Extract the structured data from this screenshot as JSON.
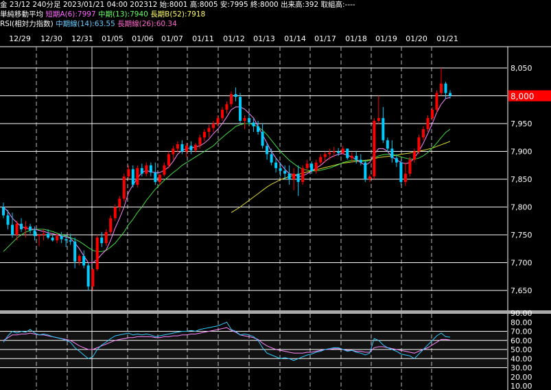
{
  "header": {
    "line1": "金 23/12 240分足 2023/01/21 04:00 202312 始:8001 高:8005 安:7995 終:8000 出来高:392 取組高:----",
    "ma_title": "単純移動平均",
    "ma_short": "短期A(6):7997",
    "ma_mid": "中期(13):7940",
    "ma_long": "長期B(52):7918",
    "rsi_title": "RSI(相対力指数)",
    "rsi_mid": "中期線(14):63.55",
    "rsi_long": "長期線(26):60.34"
  },
  "colors": {
    "up": "#ff0000",
    "down": "#00ccff",
    "ma_short": "#ff88ff",
    "ma_mid": "#44dd44",
    "ma_long": "#dddd33",
    "rsi_mid": "#33ccff",
    "rsi_long": "#ff88ff",
    "current_price_bg": "#ff0000"
  },
  "chart_data": [
    {
      "type": "candlestick",
      "title": "",
      "x_labels": [
        "12/29",
        "12/30",
        "12/31",
        "01/05",
        "01/06",
        "01/07",
        "01/11",
        "01/12",
        "01/13",
        "01/14",
        "01/17",
        "01/18",
        "01/19",
        "01/20",
        "01/21"
      ],
      "y_ticks": [
        "8,050",
        "8,000",
        "7,950",
        "7,900",
        "7,850",
        "7,800",
        "7,750",
        "7,700",
        "7,650"
      ],
      "ylim": [
        7625,
        8080
      ],
      "current_price_label": "8,000",
      "current_price": 8000,
      "candles": [
        [
          7800,
          7808,
          7780,
          7785
        ],
        [
          7785,
          7795,
          7760,
          7768
        ],
        [
          7768,
          7790,
          7745,
          7750
        ],
        [
          7750,
          7775,
          7740,
          7770
        ],
        [
          7770,
          7780,
          7755,
          7760
        ],
        [
          7760,
          7775,
          7745,
          7765
        ],
        [
          7765,
          7770,
          7752,
          7758
        ],
        [
          7758,
          7765,
          7740,
          7748
        ],
        [
          7748,
          7752,
          7730,
          7750
        ],
        [
          7750,
          7760,
          7740,
          7752
        ],
        [
          7752,
          7760,
          7742,
          7745
        ],
        [
          7745,
          7750,
          7738,
          7740
        ],
        [
          7740,
          7752,
          7735,
          7748
        ],
        [
          7748,
          7755,
          7735,
          7742
        ],
        [
          7742,
          7750,
          7728,
          7740
        ],
        [
          7740,
          7752,
          7732,
          7738
        ],
        [
          7738,
          7745,
          7690,
          7702
        ],
        [
          7702,
          7715,
          7695,
          7712
        ],
        [
          7712,
          7722,
          7690,
          7695
        ],
        [
          7695,
          7700,
          7650,
          7657
        ],
        [
          7657,
          7690,
          7650,
          7688
        ],
        [
          7688,
          7750,
          7685,
          7745
        ],
        [
          7745,
          7755,
          7728,
          7735
        ],
        [
          7735,
          7760,
          7730,
          7755
        ],
        [
          7755,
          7785,
          7750,
          7780
        ],
        [
          7780,
          7805,
          7775,
          7800
        ],
        [
          7800,
          7820,
          7792,
          7815
        ],
        [
          7815,
          7860,
          7810,
          7855
        ],
        [
          7855,
          7875,
          7850,
          7868
        ],
        [
          7868,
          7875,
          7835,
          7840
        ],
        [
          7840,
          7875,
          7835,
          7870
        ],
        [
          7870,
          7878,
          7855,
          7860
        ],
        [
          7860,
          7880,
          7855,
          7875
        ],
        [
          7875,
          7880,
          7855,
          7862
        ],
        [
          7862,
          7880,
          7840,
          7845
        ],
        [
          7845,
          7860,
          7840,
          7858
        ],
        [
          7858,
          7880,
          7855,
          7875
        ],
        [
          7875,
          7900,
          7870,
          7895
        ],
        [
          7895,
          7910,
          7885,
          7905
        ],
        [
          7905,
          7918,
          7898,
          7913
        ],
        [
          7913,
          7920,
          7895,
          7900
        ],
        [
          7900,
          7915,
          7890,
          7910
        ],
        [
          7910,
          7918,
          7895,
          7902
        ],
        [
          7902,
          7915,
          7898,
          7912
        ],
        [
          7912,
          7930,
          7905,
          7925
        ],
        [
          7925,
          7940,
          7918,
          7935
        ],
        [
          7935,
          7948,
          7925,
          7942
        ],
        [
          7942,
          7955,
          7935,
          7950
        ],
        [
          7950,
          7965,
          7945,
          7960
        ],
        [
          7960,
          7980,
          7955,
          7975
        ],
        [
          7975,
          7990,
          7968,
          7985
        ],
        [
          7985,
          8008,
          7980,
          8003
        ],
        [
          8003,
          8015,
          7990,
          7998
        ],
        [
          7998,
          8005,
          7950,
          7955
        ],
        [
          7955,
          7965,
          7940,
          7960
        ],
        [
          7960,
          7968,
          7948,
          7952
        ],
        [
          7952,
          7960,
          7935,
          7945
        ],
        [
          7945,
          7955,
          7930,
          7935
        ],
        [
          7935,
          7950,
          7905,
          7910
        ],
        [
          7910,
          7915,
          7885,
          7895
        ],
        [
          7895,
          7905,
          7875,
          7880
        ],
        [
          7880,
          7888,
          7862,
          7870
        ],
        [
          7870,
          7880,
          7855,
          7865
        ],
        [
          7865,
          7875,
          7850,
          7860
        ],
        [
          7860,
          7875,
          7840,
          7850
        ],
        [
          7850,
          7870,
          7830,
          7860
        ],
        [
          7860,
          7875,
          7820,
          7845
        ],
        [
          7845,
          7875,
          7840,
          7870
        ],
        [
          7870,
          7885,
          7865,
          7878
        ],
        [
          7878,
          7882,
          7860,
          7865
        ],
        [
          7865,
          7885,
          7860,
          7880
        ],
        [
          7880,
          7895,
          7875,
          7890
        ],
        [
          7890,
          7900,
          7880,
          7895
        ],
        [
          7895,
          7905,
          7885,
          7898
        ],
        [
          7898,
          7908,
          7890,
          7900
        ],
        [
          7900,
          7906,
          7892,
          7897
        ],
        [
          7897,
          7910,
          7895,
          7905
        ],
        [
          7905,
          7905,
          7885,
          7888
        ],
        [
          7888,
          7898,
          7882,
          7892
        ],
        [
          7892,
          7900,
          7878,
          7885
        ],
        [
          7885,
          7895,
          7875,
          7880
        ],
        [
          7880,
          7885,
          7845,
          7850
        ],
        [
          7850,
          7858,
          7845,
          7855
        ],
        [
          7855,
          7960,
          7850,
          7955
        ],
        [
          7955,
          8000,
          7950,
          7960
        ],
        [
          7960,
          7980,
          7915,
          7920
        ],
        [
          7920,
          7925,
          7900,
          7905
        ],
        [
          7905,
          7920,
          7880,
          7888
        ],
        [
          7888,
          7895,
          7872,
          7880
        ],
        [
          7880,
          7885,
          7840,
          7845
        ],
        [
          7845,
          7880,
          7838,
          7860
        ],
        [
          7860,
          7890,
          7855,
          7885
        ],
        [
          7885,
          7905,
          7880,
          7900
        ],
        [
          7900,
          7930,
          7895,
          7925
        ],
        [
          7925,
          7945,
          7920,
          7940
        ],
        [
          7940,
          7965,
          7935,
          7960
        ],
        [
          7960,
          7980,
          7955,
          7975
        ],
        [
          7975,
          8010,
          7970,
          8005
        ],
        [
          8005,
          8050,
          8000,
          8022
        ],
        [
          8022,
          8025,
          7995,
          8005
        ],
        [
          8005,
          8010,
          7995,
          8000
        ]
      ],
      "ma_short": [
        7800,
        7792,
        7780,
        7772,
        7765,
        7762,
        7760,
        7760,
        7758,
        7756,
        7754,
        7752,
        7750,
        7748,
        7746,
        7744,
        7735,
        7725,
        7712,
        7700,
        7700,
        7706,
        7715,
        7723,
        7740,
        7762,
        7780,
        7800,
        7826,
        7840,
        7852,
        7862,
        7866,
        7863,
        7862,
        7862,
        7866,
        7872,
        7882,
        7895,
        7902,
        7905,
        7906,
        7908,
        7910,
        7915,
        7922,
        7932,
        7940,
        7950,
        7962,
        7975,
        7980,
        7980,
        7976,
        7968,
        7960,
        7945,
        7930,
        7915,
        7900,
        7888,
        7878,
        7868,
        7860,
        7858,
        7855,
        7856,
        7860,
        7865,
        7870,
        7875,
        7882,
        7888,
        7892,
        7895,
        7896,
        7893,
        7890,
        7885,
        7880,
        7875,
        7880,
        7895,
        7905,
        7905,
        7900,
        7890,
        7885,
        7880,
        7878,
        7880,
        7888,
        7900,
        7915,
        7932,
        7950,
        7970,
        7985,
        7995,
        7997
      ],
      "ma_mid": [
        7720,
        7728,
        7736,
        7744,
        7750,
        7755,
        7758,
        7760,
        7760,
        7760,
        7758,
        7756,
        7753,
        7750,
        7748,
        7745,
        7742,
        7738,
        7733,
        7727,
        7722,
        7720,
        7720,
        7722,
        7728,
        7735,
        7745,
        7755,
        7768,
        7778,
        7790,
        7800,
        7812,
        7822,
        7832,
        7840,
        7848,
        7855,
        7862,
        7868,
        7875,
        7880,
        7885,
        7890,
        7895,
        7900,
        7905,
        7910,
        7918,
        7925,
        7932,
        7938,
        7945,
        7948,
        7950,
        7950,
        7948,
        7944,
        7938,
        7930,
        7920,
        7910,
        7900,
        7892,
        7884,
        7878,
        7872,
        7868,
        7866,
        7865,
        7865,
        7866,
        7868,
        7870,
        7873,
        7876,
        7880,
        7882,
        7884,
        7884,
        7883,
        7882,
        7884,
        7888,
        7892,
        7894,
        7895,
        7895,
        7893,
        7890,
        7888,
        7886,
        7886,
        7888,
        7892,
        7898,
        7906,
        7915,
        7925,
        7934,
        7940
      ],
      "ma_long": [
        null,
        null,
        null,
        null,
        null,
        null,
        null,
        null,
        null,
        null,
        null,
        null,
        null,
        null,
        null,
        null,
        null,
        null,
        null,
        null,
        null,
        null,
        null,
        null,
        null,
        null,
        null,
        null,
        null,
        null,
        null,
        null,
        null,
        null,
        null,
        null,
        null,
        null,
        null,
        null,
        null,
        null,
        null,
        null,
        null,
        null,
        null,
        null,
        null,
        null,
        null,
        7790,
        7795,
        7800,
        7806,
        7812,
        7818,
        7824,
        7830,
        7836,
        7841,
        7845,
        7849,
        7852,
        7855,
        7857,
        7859,
        7861,
        7863,
        7865,
        7867,
        7869,
        7871,
        7873,
        7875,
        7877,
        7879,
        7880,
        7881,
        7882,
        7883,
        7884,
        7885,
        7887,
        7889,
        7890,
        7891,
        7892,
        7893,
        7895,
        7896,
        7897,
        7899,
        7900,
        7902,
        7904,
        7906,
        7909,
        7912,
        7915,
        7918
      ]
    },
    {
      "type": "line",
      "title": "",
      "y_ticks": [
        "90.00",
        "80.00",
        "70.00",
        "60.00",
        "50.00",
        "40.00",
        "30.00",
        "20.00",
        "10.00"
      ],
      "ylim": [
        8,
        92
      ],
      "series": [
        {
          "name": "中期線(14)",
          "values": [
            58,
            65,
            70,
            68,
            70,
            69,
            72,
            68,
            66,
            67,
            66,
            64,
            63,
            62,
            60,
            58,
            52,
            48,
            44,
            40,
            42,
            50,
            55,
            58,
            62,
            65,
            66,
            67,
            68,
            66,
            67,
            66,
            67,
            66,
            64,
            65,
            66,
            67,
            68,
            69,
            70,
            70,
            71,
            70,
            72,
            73,
            74,
            75,
            76,
            78,
            80,
            72,
            70,
            66,
            67,
            66,
            64,
            60,
            52,
            46,
            44,
            42,
            40,
            41,
            40,
            38,
            40,
            42,
            44,
            45,
            47,
            48,
            50,
            51,
            52,
            52,
            50,
            48,
            49,
            47,
            46,
            44,
            46,
            62,
            60,
            55,
            52,
            50,
            48,
            45,
            44,
            43,
            40,
            45,
            50,
            55,
            60,
            65,
            68,
            64,
            63.55
          ]
        },
        {
          "name": "長期線(26)",
          "values": [
            60,
            63,
            66,
            66,
            67,
            67,
            68,
            67,
            66,
            66,
            65,
            64,
            63,
            62,
            61,
            60,
            57,
            54,
            52,
            50,
            50,
            52,
            54,
            56,
            58,
            60,
            61,
            62,
            63,
            63,
            64,
            64,
            64,
            64,
            63,
            63,
            64,
            64,
            65,
            65,
            66,
            66,
            67,
            67,
            68,
            69,
            70,
            71,
            72,
            73,
            74,
            71,
            69,
            66,
            65,
            64,
            63,
            61,
            57,
            54,
            52,
            50,
            49,
            48,
            47,
            46,
            46,
            46,
            47,
            47,
            48,
            49,
            50,
            50,
            51,
            51,
            50,
            49,
            49,
            48,
            48,
            47,
            47,
            52,
            53,
            53,
            52,
            51,
            50,
            49,
            48,
            47,
            46,
            48,
            50,
            52,
            55,
            58,
            61,
            61,
            60.34
          ]
        }
      ],
      "grid_lines": [
        70,
        60,
        50,
        40,
        30
      ]
    }
  ]
}
